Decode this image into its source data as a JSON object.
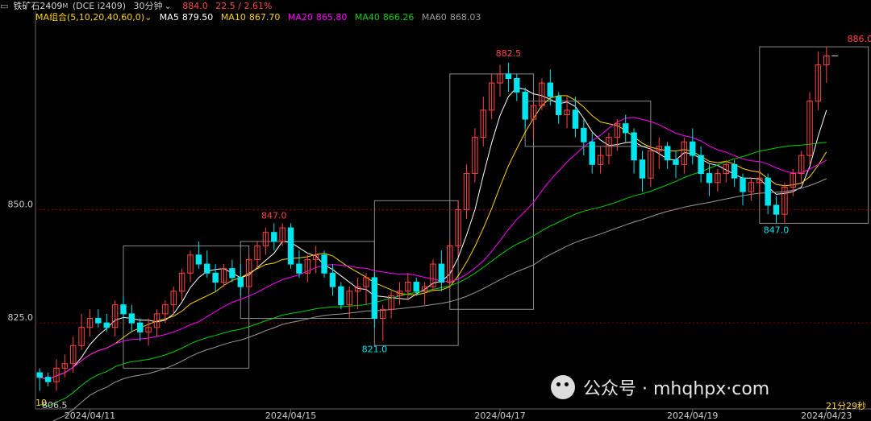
{
  "header": {
    "icon": "book-icon",
    "symbol": "铁矿石2409",
    "badge": "M",
    "code": "(DCE i2409)",
    "period": "30分钟",
    "price": "884.0",
    "change": "22.5 / 2.61%"
  },
  "ma_legend": {
    "group": "MA组合(5,10,20,40,60,0)",
    "items": [
      {
        "label": "MA5",
        "value": "879.50",
        "color": "#ffffff"
      },
      {
        "label": "MA10",
        "value": "867.70",
        "color": "#ffd400"
      },
      {
        "label": "MA20",
        "value": "865.80",
        "color": "#ff00ff"
      },
      {
        "label": "MA40",
        "value": "866.26",
        "color": "#00d200"
      },
      {
        "label": "MA60",
        "value": "868.03",
        "color": "#9a9a9a"
      }
    ]
  },
  "colors": {
    "up": "#ff4444",
    "down": "#00e5ee",
    "grid": "#8b0000",
    "box": "#8a8a8a"
  },
  "annotations": {
    "high1": "847.0",
    "low1": "821.0",
    "high2": "882.5",
    "high3": "886.0",
    "low3": "847.0",
    "left_cut": "10",
    "left_value": "806.5"
  },
  "watermark": {
    "text": "公众号 · mhqhpx·com",
    "icon": "wechat-icon"
  },
  "timer": "21分29秒",
  "chart_data": {
    "type": "candlestick",
    "y_ticks": [
      825.0,
      850.0
    ],
    "y_tick_labels": [
      "825.0",
      "850.0"
    ],
    "x_labels": [
      "2024/04/11",
      "2024/04/15",
      "2024/04/17",
      "2024/04/19",
      "2024/04/23"
    ],
    "ylim": [
      806,
      891
    ],
    "candles": [
      [
        814,
        815,
        810,
        813
      ],
      [
        813,
        814,
        811,
        812
      ],
      [
        812,
        817,
        810,
        815
      ],
      [
        815,
        818,
        813,
        816
      ],
      [
        816,
        822,
        814,
        820
      ],
      [
        820,
        827,
        819,
        824
      ],
      [
        824,
        828,
        822,
        826
      ],
      [
        826,
        828,
        824,
        825
      ],
      [
        825,
        827,
        823,
        824
      ],
      [
        824,
        830,
        822,
        829
      ],
      [
        829,
        831,
        826,
        827
      ],
      [
        827,
        829,
        823,
        825
      ],
      [
        825,
        826,
        821,
        823
      ],
      [
        823,
        826,
        820,
        824
      ],
      [
        824,
        828,
        822,
        827
      ],
      [
        827,
        830,
        825,
        829
      ],
      [
        829,
        833,
        827,
        832
      ],
      [
        832,
        837,
        830,
        836
      ],
      [
        836,
        841,
        834,
        840
      ],
      [
        840,
        843,
        837,
        838
      ],
      [
        838,
        841,
        835,
        836
      ],
      [
        836,
        838,
        832,
        834
      ],
      [
        834,
        838,
        833,
        837
      ],
      [
        837,
        839,
        834,
        835
      ],
      [
        835,
        838,
        831,
        833
      ],
      [
        833,
        840,
        832,
        839
      ],
      [
        839,
        843,
        837,
        842
      ],
      [
        842,
        846,
        840,
        845
      ],
      [
        845,
        847,
        841,
        843
      ],
      [
        843,
        847,
        842,
        846
      ],
      [
        846,
        847,
        837,
        838
      ],
      [
        838,
        841,
        835,
        836
      ],
      [
        836,
        840,
        834,
        839
      ],
      [
        839,
        842,
        836,
        840
      ],
      [
        840,
        841,
        835,
        836
      ],
      [
        836,
        838,
        831,
        833
      ],
      [
        833,
        834,
        828,
        829
      ],
      [
        829,
        833,
        826,
        832
      ],
      [
        832,
        835,
        828,
        833
      ],
      [
        833,
        836,
        829,
        835
      ],
      [
        835,
        836,
        824,
        826
      ],
      [
        826,
        829,
        821,
        828
      ],
      [
        828,
        832,
        826,
        831
      ],
      [
        831,
        834,
        829,
        832
      ],
      [
        832,
        836,
        830,
        834
      ],
      [
        834,
        835,
        831,
        832
      ],
      [
        832,
        834,
        829,
        833
      ],
      [
        833,
        839,
        832,
        838
      ],
      [
        838,
        841,
        832,
        834
      ],
      [
        834,
        843,
        833,
        842
      ],
      [
        842,
        852,
        840,
        850
      ],
      [
        850,
        860,
        848,
        858
      ],
      [
        858,
        868,
        856,
        866
      ],
      [
        866,
        875,
        864,
        872
      ],
      [
        872,
        880,
        870,
        878
      ],
      [
        878,
        882,
        875,
        880
      ],
      [
        880,
        882.5,
        876,
        879
      ],
      [
        879,
        880,
        874,
        876
      ],
      [
        876,
        877,
        868,
        870
      ],
      [
        870,
        874,
        866,
        873
      ],
      [
        873,
        879,
        872,
        878
      ],
      [
        878,
        881,
        873,
        875
      ],
      [
        875,
        876,
        869,
        871
      ],
      [
        871,
        875,
        868,
        872
      ],
      [
        872,
        875,
        866,
        868
      ],
      [
        868,
        870,
        862,
        865
      ],
      [
        865,
        867,
        858,
        860
      ],
      [
        860,
        864,
        858,
        862
      ],
      [
        862,
        867,
        860,
        866
      ],
      [
        866,
        870,
        863,
        869
      ],
      [
        869,
        871,
        865,
        867
      ],
      [
        867,
        868,
        858,
        861
      ],
      [
        861,
        863,
        854,
        857
      ],
      [
        857,
        864,
        855,
        863
      ],
      [
        863,
        866,
        859,
        864
      ],
      [
        864,
        865,
        859,
        861
      ],
      [
        861,
        863,
        857,
        860
      ],
      [
        860,
        866,
        858,
        865
      ],
      [
        865,
        868,
        860,
        862
      ],
      [
        862,
        864,
        856,
        858
      ],
      [
        858,
        860,
        853,
        856
      ],
      [
        856,
        859,
        854,
        858
      ],
      [
        858,
        861,
        856,
        860
      ],
      [
        860,
        861,
        855,
        857
      ],
      [
        857,
        858,
        851,
        854
      ],
      [
        854,
        857,
        852,
        856
      ],
      [
        856,
        859,
        853,
        857
      ],
      [
        857,
        858,
        849,
        851
      ],
      [
        851,
        853,
        847,
        849
      ],
      [
        849,
        856,
        847,
        855
      ],
      [
        855,
        859,
        853,
        858
      ],
      [
        858,
        863,
        856,
        862
      ],
      [
        862,
        876,
        860,
        874
      ],
      [
        874,
        885,
        872,
        882
      ],
      [
        882,
        886,
        878,
        884
      ]
    ],
    "series": [
      {
        "name": "MA5",
        "color": "#ffffff"
      },
      {
        "name": "MA10",
        "color": "#ffd400"
      },
      {
        "name": "MA20",
        "color": "#ff00ff"
      },
      {
        "name": "MA40",
        "color": "#00d200"
      },
      {
        "name": "MA60",
        "color": "#9a9a9a"
      }
    ]
  }
}
